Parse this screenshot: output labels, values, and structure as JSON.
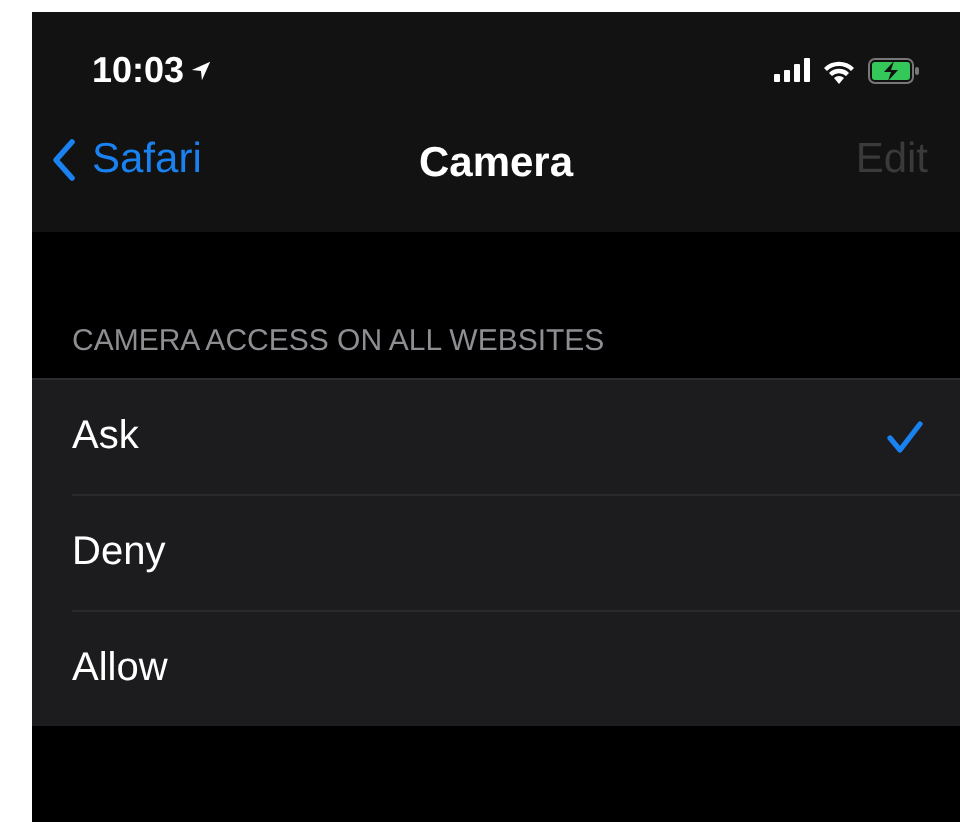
{
  "status_bar": {
    "time": "10:03"
  },
  "nav": {
    "back": "Safari",
    "title": "Camera",
    "edit": {
      "label": "Edit",
      "disabled": true
    }
  },
  "section": {
    "header": "CAMERA ACCESS ON ALL WEBSITES"
  },
  "options": [
    {
      "label": "Ask",
      "selected": true
    },
    {
      "label": "Deny",
      "selected": false
    },
    {
      "label": "Allow",
      "selected": false
    }
  ]
}
